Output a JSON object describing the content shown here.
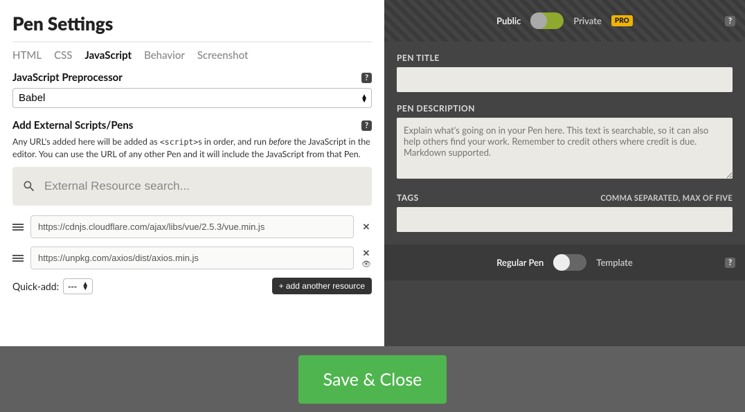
{
  "title": "Pen Settings",
  "tabs": [
    "HTML",
    "CSS",
    "JavaScript",
    "Behavior",
    "Screenshot"
  ],
  "active_tab": 2,
  "preprocessor": {
    "label": "JavaScript Preprocessor",
    "value": "Babel"
  },
  "external": {
    "label": "Add External Scripts/Pens",
    "help_pre": "Any URL's added here will be added as ",
    "help_code": "<script>",
    "help_mid": "s in order, and run ",
    "help_em": "before",
    "help_post": " the JavaScript in the editor. You can use the URL of any other Pen and it will include the JavaScript from that Pen.",
    "search_placeholder": "External Resource search..."
  },
  "resources": [
    "https://cdnjs.cloudflare.com/ajax/libs/vue/2.5.3/vue.min.js",
    "https://unpkg.com/axios/dist/axios.min.js"
  ],
  "quick_add": {
    "label": "Quick-add:",
    "value": "---"
  },
  "add_button": "+ add another resource",
  "privacy": {
    "left": "Public",
    "right": "Private",
    "pro": "PRO"
  },
  "pen_title_label": "PEN TITLE",
  "pen_desc_label": "PEN DESCRIPTION",
  "pen_desc_placeholder": "Explain what's going on in your Pen here. This text is searchable, so it can also help others find your work. Remember to credit others where credit is due. Markdown supported.",
  "tags_label": "TAGS",
  "tags_hint": "COMMA SEPARATED, MAX OF FIVE",
  "template": {
    "left": "Regular Pen",
    "right": "Template"
  },
  "save_button": "Save & Close"
}
